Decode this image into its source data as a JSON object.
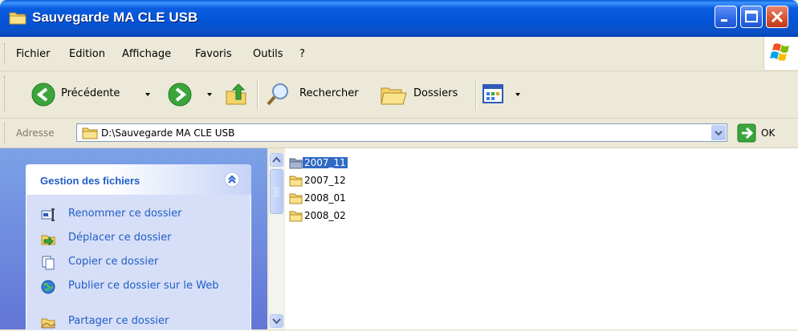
{
  "window": {
    "title": "Sauvegarde MA CLE USB",
    "controls": [
      "minimize",
      "maximize",
      "close"
    ]
  },
  "menu": {
    "items": [
      "Fichier",
      "Edition",
      "Affichage",
      "Favoris",
      "Outils",
      "?"
    ]
  },
  "toolbar": {
    "back_label": "Précédente",
    "search_label": "Rechercher",
    "folders_label": "Dossiers"
  },
  "address": {
    "label": "Adresse",
    "path": "D:\\Sauvegarde MA CLE USB",
    "go_label": "OK"
  },
  "task_pane": {
    "title": "Gestion des fichiers",
    "tasks": [
      {
        "label": "Renommer ce dossier",
        "icon": "rename-icon"
      },
      {
        "label": "Déplacer ce dossier",
        "icon": "move-icon"
      },
      {
        "label": "Copier ce dossier",
        "icon": "copy-icon"
      },
      {
        "label": "Publier ce dossier sur le Web",
        "icon": "publish-web-icon"
      },
      {
        "label": "Partager ce dossier",
        "icon": "share-icon"
      }
    ]
  },
  "files": [
    {
      "name": "2007_11",
      "selected": true
    },
    {
      "name": "2007_12",
      "selected": false
    },
    {
      "name": "2008_01",
      "selected": false
    },
    {
      "name": "2008_02",
      "selected": false
    }
  ],
  "colors": {
    "title_bar": "#0454D8",
    "task_link": "#215DC6",
    "selection": "#316AC5"
  }
}
